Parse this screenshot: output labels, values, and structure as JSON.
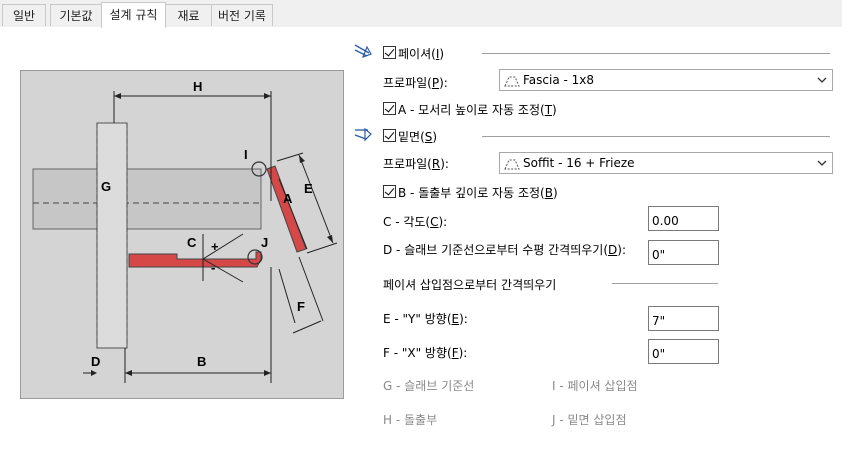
{
  "tabs": [
    {
      "label": "일반"
    },
    {
      "label": "기본값"
    },
    {
      "label": "설계 규칙"
    },
    {
      "label": "재료"
    },
    {
      "label": "버전 기록"
    }
  ],
  "diagram": {
    "labels": {
      "H": "H",
      "G": "G",
      "I": "I",
      "E": "E",
      "A": "A",
      "C": "C",
      "J": "J",
      "F": "F",
      "D": "D",
      "B": "B",
      "plus": "+",
      "minus": "-"
    }
  },
  "fascia": {
    "checkbox_label": "페이셔",
    "checkbox_key": "I",
    "profile_label": "프로파일",
    "profile_key": "P",
    "profile_value": "Fascia - 1x8",
    "auto_label": "A - 모서리 높이로 자동 조정",
    "auto_key": "T"
  },
  "soffit": {
    "checkbox_label": "밑면",
    "checkbox_key": "S",
    "profile_label": "프로파일",
    "profile_key": "R",
    "profile_value": "Soffit - 16 + Frieze",
    "auto_label": "B - 돌출부 깊이로 자동 조정",
    "auto_key": "B"
  },
  "fields": {
    "angle_label": "C - 각도",
    "angle_key": "C",
    "angle_value": "0.00",
    "offset_label": "D - 슬래브 기준선으로부터 수평 간격띄우기",
    "offset_key": "D",
    "offset_value": "0\"",
    "group_label": "페이셔 삽입점으로부터 간격띄우기",
    "y_label": "E - \"Y\" 방향",
    "y_key": "E",
    "y_value": "7\"",
    "x_label": "F - \"X\" 방향",
    "x_key": "F",
    "x_value": "0\""
  },
  "legend": {
    "g": "G - 슬래브 기준선",
    "i": "I - 페이셔 삽입점",
    "h": "H - 돌출부",
    "j": "J - 밑면 삽입점"
  }
}
